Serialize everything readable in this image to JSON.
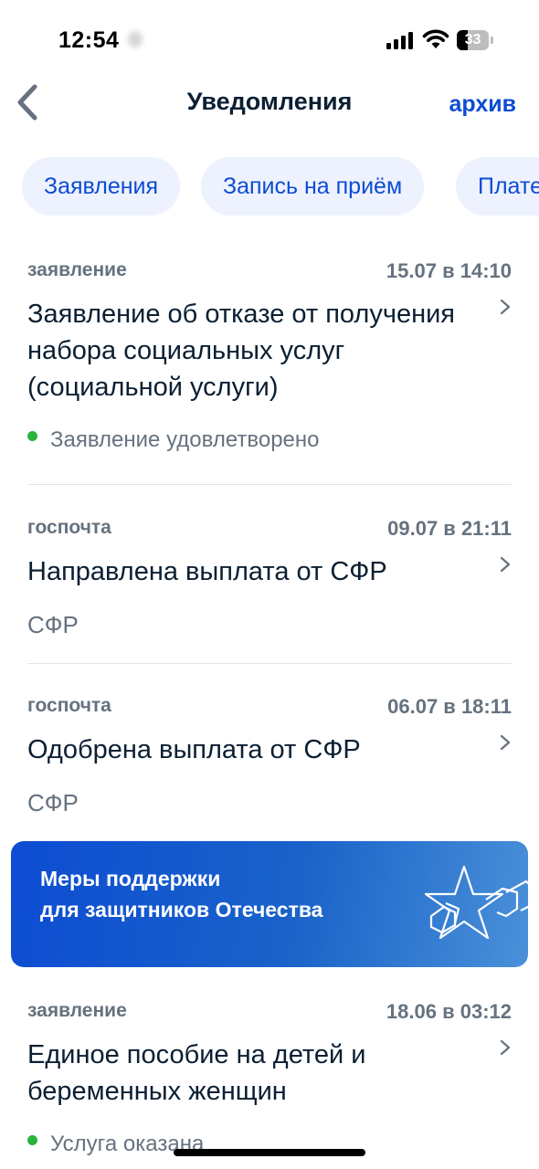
{
  "status_bar": {
    "time": "12:54",
    "battery": "33",
    "battery_level": 0.33
  },
  "nav": {
    "title": "Уведомления",
    "archive_label": "архив"
  },
  "chips": [
    "Заявления",
    "Запись на приём",
    "Платежи"
  ],
  "notifications": [
    {
      "category": "заявление",
      "date": "15.07 в 14:10",
      "title": "Заявление об отказе от получения набора социальных услуг (социальной услуги)",
      "status": "Заявление удовлетворено"
    },
    {
      "category": "госпочта",
      "date": "09.07 в 21:11",
      "title": "Направлена выплата от СФР",
      "sender": "СФР"
    },
    {
      "category": "госпочта",
      "date": "06.07 в 18:11",
      "title": "Одобрена выплата от СФР",
      "sender": "СФР"
    },
    {
      "category": "заявление",
      "date": "18.06 в 03:12",
      "title": "Единое пособие на детей и беременных женщин",
      "status": "Услуга оказана"
    }
  ],
  "banner": {
    "line1": "Меры поддержки",
    "line2": "для защитников Отечества"
  },
  "colors": {
    "accent": "#0d4cd3",
    "chip_bg": "#edf2fe",
    "status_green": "#2bb33d",
    "secondary_text": "#66727f"
  }
}
